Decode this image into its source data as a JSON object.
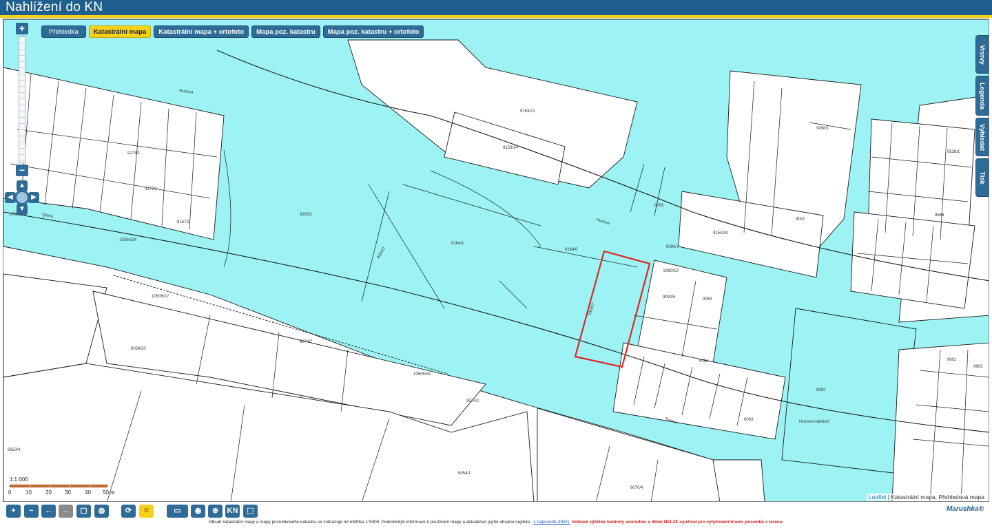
{
  "app": {
    "title": "Nahlížení do KN"
  },
  "layer_tabs": [
    {
      "label": "Přehledka",
      "active": false
    },
    {
      "label": "Katastrální mapa",
      "active": true
    },
    {
      "label": "Katastrální mapa + ortofoto",
      "active": false
    },
    {
      "label": "Mapa poz. katastru",
      "active": false
    },
    {
      "label": "Mapa poz. katastru + ortofoto",
      "active": false
    }
  ],
  "zoom": {
    "in_label": "+",
    "out_label": "−"
  },
  "side_tabs": [
    "Vrstvy",
    "Legenda",
    "Vyhledat",
    "Tisk"
  ],
  "scale": {
    "ratio": "1:1 000",
    "labels": [
      "0",
      "10",
      "20",
      "30",
      "40",
      "50 m"
    ]
  },
  "attribution": {
    "link": "Leaflet",
    "text": "| Katastrální mapa, Přehledová mapa"
  },
  "map_labels": {
    "street_1": "Husova",
    "street_2": "Husova",
    "street_3": "Tylova",
    "street_4": "Tylova",
    "square": "Husovo náměstí",
    "parcel_main": "9164/1",
    "parcel_sel": "9164/7",
    "parcel_a": "9153/21",
    "parcel_b": "9153/14",
    "parcel_c": "9163/1",
    "parcel_d": "9164/2",
    "parcel_e": "9164/6",
    "parcel_f": "9090/5",
    "parcel_g": "9089",
    "parcel_h": "9098/1",
    "parcel_i": "9093",
    "parcel_j": "9097",
    "parcel_k": "9054/1",
    "parcel_l": "9074/7",
    "parcel_m": "9070/4",
    "parcel_n": "9092",
    "parcel_o": "9084",
    "parcel_p": "9083",
    "parcel_q": "10506/29",
    "parcel_r": "10506/24",
    "parcel_s": "10506/22",
    "parcel_t": "9167/2",
    "parcel_u": "9177/1",
    "parcel_v": "9173/1",
    "parcel_w": "9154/30",
    "parcel_x": "9074/2",
    "parcel_y": "9054/20",
    "parcel_z": "10506/33",
    "parcel_aa": "9150/4",
    "parcel_ab": "9602",
    "parcel_ac": "9603",
    "parcel_ad": "9538/1",
    "parcel_ae": "9586",
    "parcel_af": "9090/10",
    "parcel_ag": "9090/7"
  },
  "toolbar": {
    "buttons": [
      "+",
      "−",
      "←",
      "→",
      "▢",
      "◍",
      "⟳",
      "✕",
      "▭",
      "◉",
      "⊕",
      "KN",
      "⬚"
    ],
    "brand": "Marushka®"
  },
  "footer": {
    "text": "Obsah katastrální mapy a mapy pozemkového katastru se zobrazuje od měřítka 1:5000. Podrobnější informace k používání mapy a aktualizaci jejího obsahu najdete",
    "link": "v nápovědě (PDF).",
    "warning": "Veškeré zjištěné hodnoty souřadnic a délek NELZE využívat pro vytyčování hranic pozemků v terénu."
  },
  "colors": {
    "header": "#1f5f8e",
    "accent": "#f4d21c",
    "parcel_fill": "#9df3f3",
    "selection": "#e02424"
  }
}
